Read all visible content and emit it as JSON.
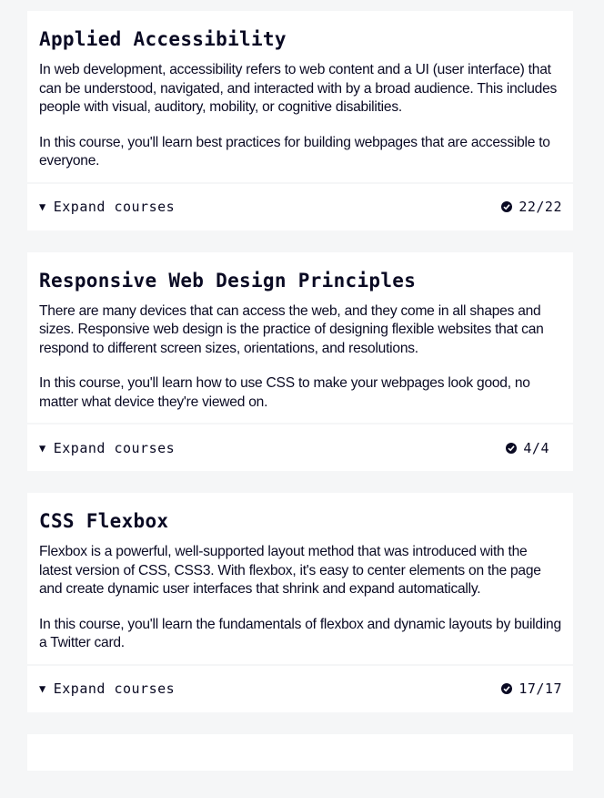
{
  "cards": [
    {
      "title": "Applied Accessibility",
      "paragraphs": [
        "In web development, accessibility refers to web content and a UI (user interface) that can be understood, navigated, and interacted with by a broad audience. This includes people with visual, auditory, mobility, or cognitive disabilities.",
        "In this course, you'll learn best practices for building webpages that are accessible to everyone."
      ],
      "expand_label": "Expand courses",
      "progress": "22/22"
    },
    {
      "title": "Responsive Web Design Principles",
      "paragraphs": [
        "There are many devices that can access the web, and they come in all shapes and sizes. Responsive web design is the practice of designing flexible websites that can respond to different screen sizes, orientations, and resolutions.",
        "In this course, you'll learn how to use CSS to make your webpages look good, no matter what device they're viewed on."
      ],
      "expand_label": "Expand courses",
      "progress": "4/4"
    },
    {
      "title": "CSS Flexbox",
      "paragraphs": [
        "Flexbox is a powerful, well-supported layout method that was introduced with the latest version of CSS, CSS3. With flexbox, it's easy to center elements on the page and create dynamic user interfaces that shrink and expand automatically.",
        "In this course, you'll learn the fundamentals of flexbox and dynamic layouts by building a Twitter card."
      ],
      "expand_label": "Expand courses",
      "progress": "17/17"
    }
  ],
  "icons": {
    "expand": "triangle-down-icon",
    "complete": "check-circle-icon"
  }
}
